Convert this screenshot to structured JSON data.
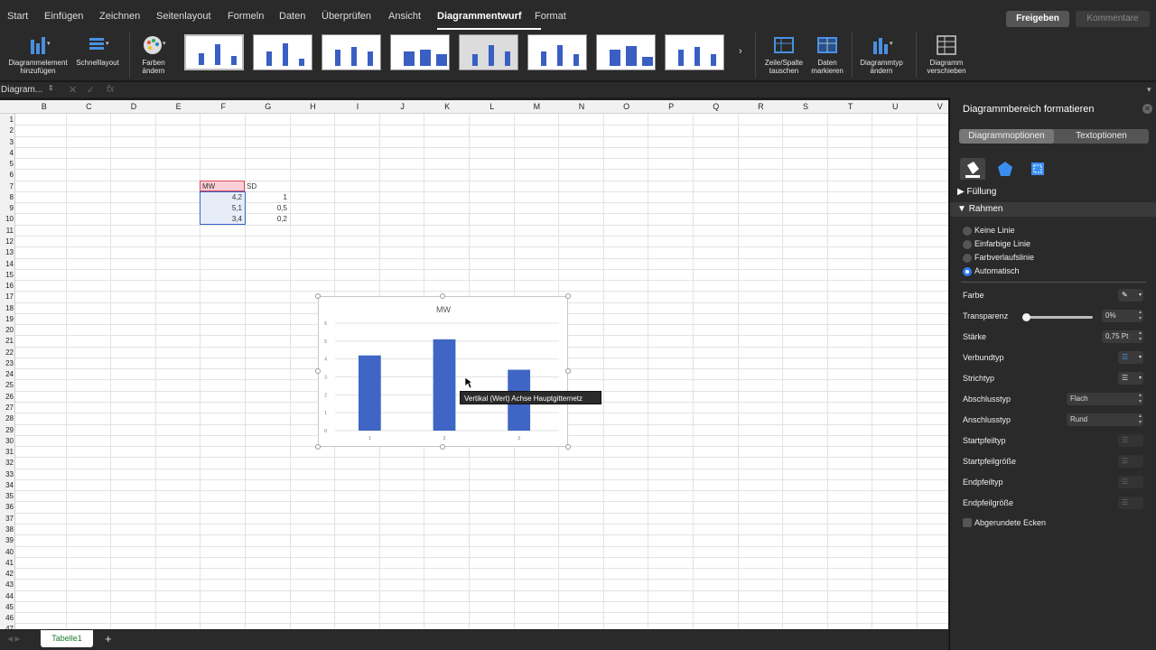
{
  "menu": {
    "tabs": [
      "Start",
      "Einfügen",
      "Zeichnen",
      "Seitenlayout",
      "Formeln",
      "Daten",
      "Überprüfen",
      "Ansicht",
      "Diagrammentwurf",
      "Format"
    ],
    "share_label": "Freigeben",
    "comments_label": "Kommentare"
  },
  "ribbon": {
    "add_element": "Diagrammelement hinzufügen",
    "quick_layout": "Schnelllayout",
    "change_colors": "Farben ändern",
    "switch_row_col": "Zeile/Spalte tauschen",
    "select_data": "Daten markieren",
    "change_type": "Diagrammtyp ändern",
    "move_chart": "Diagramm verschieben"
  },
  "formula_bar": {
    "name_box": "Diagram...",
    "fx": "fx"
  },
  "sheet": {
    "columns": [
      "B",
      "C",
      "D",
      "E",
      "F",
      "G",
      "H",
      "I",
      "J",
      "K",
      "L",
      "M",
      "N",
      "O",
      "P",
      "Q",
      "R",
      "S",
      "T",
      "U",
      "V"
    ],
    "rows": [
      "1",
      "2",
      "3",
      "4",
      "5",
      "6",
      "7",
      "8",
      "9",
      "10",
      "11",
      "12",
      "13",
      "14",
      "15",
      "16",
      "17",
      "18",
      "19",
      "20",
      "21",
      "22",
      "23",
      "24",
      "25",
      "26",
      "27",
      "28",
      "29",
      "30",
      "31",
      "32",
      "33",
      "34",
      "35",
      "36",
      "37",
      "38",
      "39",
      "40",
      "41",
      "42",
      "43",
      "44",
      "45",
      "46",
      "47"
    ],
    "table": {
      "header_mw": "MW",
      "header_sd": "SD",
      "mw": [
        "4,2",
        "5,1",
        "3,4"
      ],
      "sd": [
        "1",
        "0,5",
        "0,2"
      ]
    },
    "tab_name": "Tabelle1",
    "add_sheet": "+"
  },
  "tooltip": "Vertikal (Wert) Achse Hauptgitternetz",
  "chart_data": {
    "type": "bar",
    "title": "MW",
    "categories": [
      "1",
      "2",
      "3"
    ],
    "values": [
      4.2,
      5.1,
      3.4
    ],
    "yticks": [
      "0",
      "1",
      "2",
      "3",
      "4",
      "5",
      "6"
    ],
    "ylim": [
      0,
      6
    ],
    "grid": true,
    "color": "#3f66c4"
  },
  "panel": {
    "title": "Diagrammbereich formatieren",
    "tab_chart": "Diagrammoptionen",
    "tab_text": "Textoptionen",
    "fill": "Füllung",
    "border": "Rahmen",
    "radios": [
      "Keine Linie",
      "Einfarbige Linie",
      "Farbverlaufslinie",
      "Automatisch"
    ],
    "color_label": "Farbe",
    "transparency_label": "Transparenz",
    "transparency_value": "0%",
    "width_label": "Stärke",
    "width_value": "0,75 Pt",
    "compound_label": "Verbundtyp",
    "dash_label": "Strichtyp",
    "cap_label": "Abschlusstyp",
    "cap_value": "Flach",
    "join_label": "Anschlusstyp",
    "join_value": "Rund",
    "begin_arrow_type": "Startpfeiltyp",
    "begin_arrow_size": "Startpfeilgröße",
    "end_arrow_type": "Endpfeiltyp",
    "end_arrow_size": "Endpfeilgröße",
    "rounded_corners": "Abgerundete Ecken"
  }
}
